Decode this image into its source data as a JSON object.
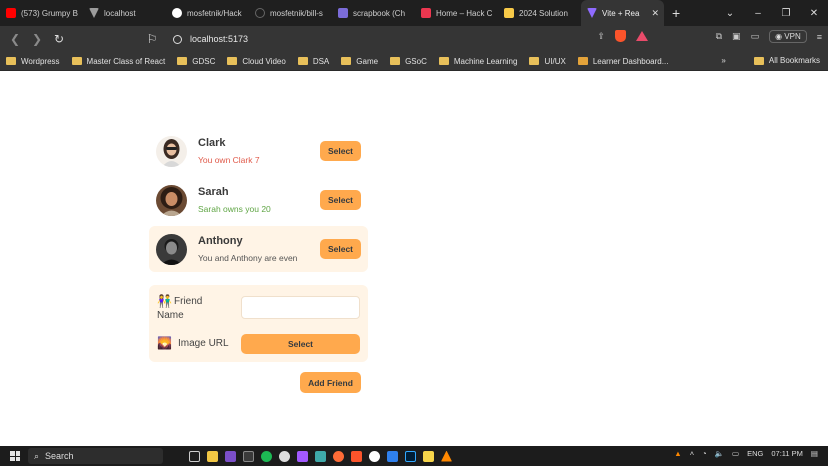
{
  "browser": {
    "tabs": [
      {
        "title": "(573) Grumpy B",
        "color": "#ff0000"
      },
      {
        "title": "localhost",
        "color": "#9c9c9c"
      },
      {
        "title": "mosfetnik/Hack",
        "color": "#ffffff"
      },
      {
        "title": "mosfetnik/bill-s",
        "color": "#555555"
      },
      {
        "title": "scrapbook (Ch",
        "color": "#7b6cd9"
      },
      {
        "title": "Home – Hack C",
        "color": "#ec3750"
      },
      {
        "title": "2024 Solution",
        "color": "#f7c948"
      },
      {
        "title": "Vite + Rea",
        "color": "#8f6bff"
      }
    ],
    "new_tab": "+",
    "window_controls": [
      "⌄",
      "–",
      "❐",
      "✕"
    ],
    "url": "localhost:5173",
    "vpn_label": "VPN",
    "bookmarks": [
      "Wordpress",
      "Master Class of React",
      "GDSC",
      "Cloud Video",
      "DSA",
      "Game",
      "GSoC",
      "Machine Learning",
      "UI/UX",
      "Learner Dashboard..."
    ],
    "bookmarks_more": "»",
    "all_bookmarks": "All Bookmarks"
  },
  "friends": [
    {
      "name": "Clark",
      "status": "You own Clark 7",
      "status_type": "red",
      "button": "Select",
      "selected": false
    },
    {
      "name": "Sarah",
      "status": "Sarah owns you 20",
      "status_type": "green",
      "button": "Select",
      "selected": false
    },
    {
      "name": "Anthony",
      "status": "You and Anthony are even",
      "status_type": "gray",
      "button": "Select",
      "selected": true
    }
  ],
  "form": {
    "name_icon": "👫",
    "name_label": "Friend Name",
    "name_label_line1": "Friend",
    "name_label_line2": "Name",
    "name_value": "",
    "image_icon": "🌄",
    "image_label": "Image URL",
    "image_button": "Select"
  },
  "add_friend_button": "Add Friend",
  "taskbar": {
    "search_label": "Search",
    "language": "ENG",
    "time": "07:11 PM"
  },
  "colors": {
    "accent": "#ffa94d",
    "selected_bg": "#fff4e6",
    "red": "#e05a4a",
    "green": "#5fa544"
  }
}
